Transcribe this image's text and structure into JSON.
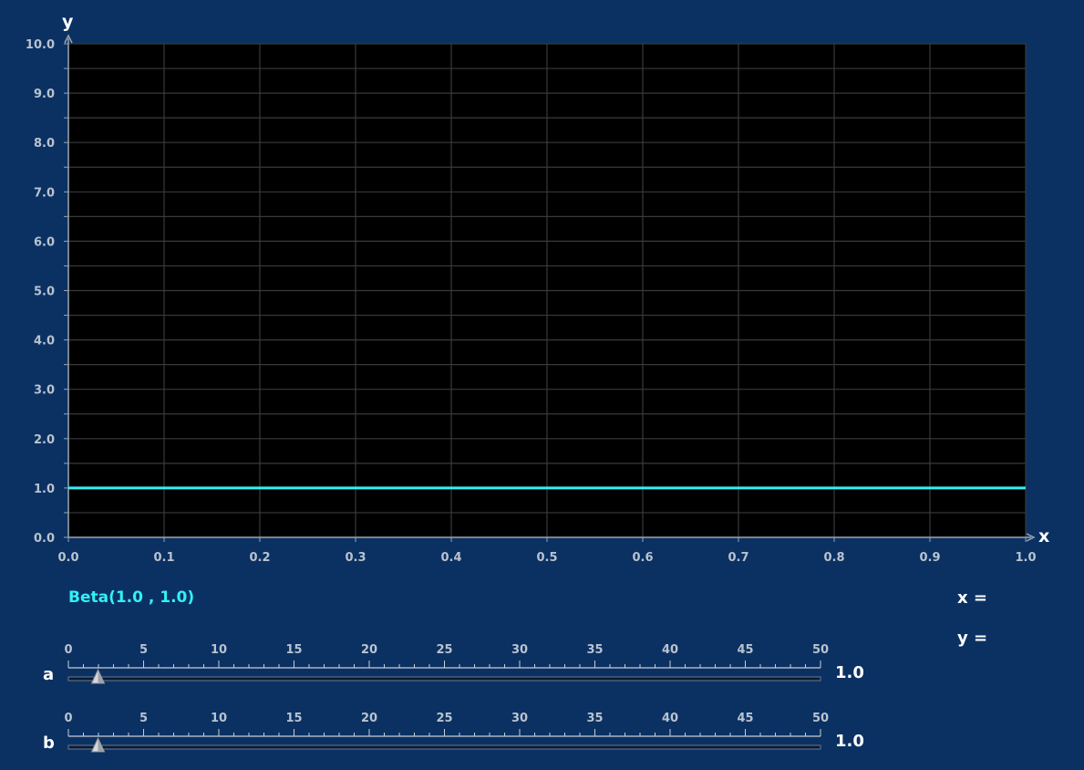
{
  "chart_data": {
    "type": "line",
    "xlabel": "x",
    "ylabel": "y",
    "xlim": [
      0.0,
      1.0
    ],
    "ylim": [
      0.0,
      10.0
    ],
    "x_ticks": [
      "0.0",
      "0.1",
      "0.2",
      "0.3",
      "0.4",
      "0.5",
      "0.6",
      "0.7",
      "0.8",
      "0.9",
      "1.0"
    ],
    "y_ticks": [
      "0.0",
      "1.0",
      "2.0",
      "3.0",
      "4.0",
      "5.0",
      "6.0",
      "7.0",
      "8.0",
      "9.0",
      "10.0"
    ],
    "grid": true,
    "series": [
      {
        "name": "Beta(1.0 , 1.0)",
        "x": [
          0.0,
          1.0
        ],
        "y": [
          1.0,
          1.0
        ],
        "color": "#33f0f5"
      }
    ]
  },
  "distribution_label": "Beta(1.0 , 1.0)",
  "readout": {
    "x_label": "x =",
    "x_value": "",
    "y_label": "y =",
    "y_value": ""
  },
  "sliders": [
    {
      "name": "a",
      "min": 0,
      "max": 50,
      "value": 1.0,
      "value_text": "1.0",
      "tick_labels": [
        "0",
        "5",
        "10",
        "15",
        "20",
        "25",
        "30",
        "35",
        "40",
        "45",
        "50"
      ]
    },
    {
      "name": "b",
      "min": 0,
      "max": 50,
      "value": 1.0,
      "value_text": "1.0",
      "tick_labels": [
        "0",
        "5",
        "10",
        "15",
        "20",
        "25",
        "30",
        "35",
        "40",
        "45",
        "50"
      ]
    }
  ],
  "colors": {
    "background": "#0b3163",
    "plot_area": "#000000",
    "grid": "#3a3a3a",
    "curve": "#33f0f5"
  }
}
